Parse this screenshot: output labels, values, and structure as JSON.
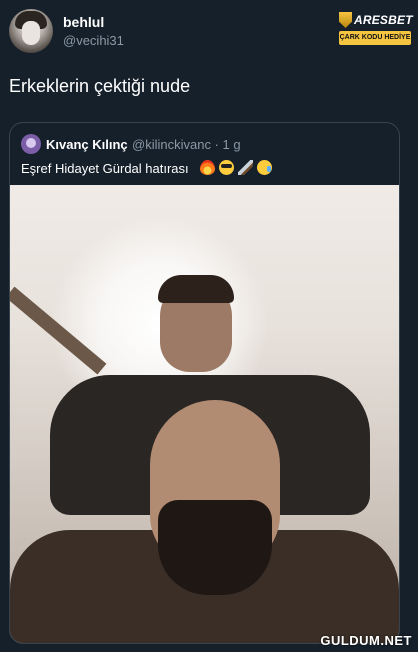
{
  "tweet": {
    "author": {
      "display_name": "behlul",
      "handle": "@vecihi31"
    },
    "text": "Erkeklerin çektiği nude"
  },
  "brand": {
    "name": "ARESBET",
    "badge": "ÇARK KODU HEDİYE",
    "accent_color": "#f5c542"
  },
  "quoted_tweet": {
    "author": {
      "display_name": "Kıvanç Kılınç",
      "handle_time": "@kilinckivanc · 1 g"
    },
    "text": "Eşref Hidayet Gürdal hatırası",
    "emojis": [
      "fire-emoji",
      "sunglasses-emoji",
      "knife-emoji",
      "sad-sweat-emoji"
    ],
    "media": {
      "type": "photo",
      "description_label": ""
    }
  },
  "watermark": "GULDUM.NET",
  "colors": {
    "background": "#15202b",
    "secondary_text": "#8b98a5",
    "border": "#38444d"
  }
}
